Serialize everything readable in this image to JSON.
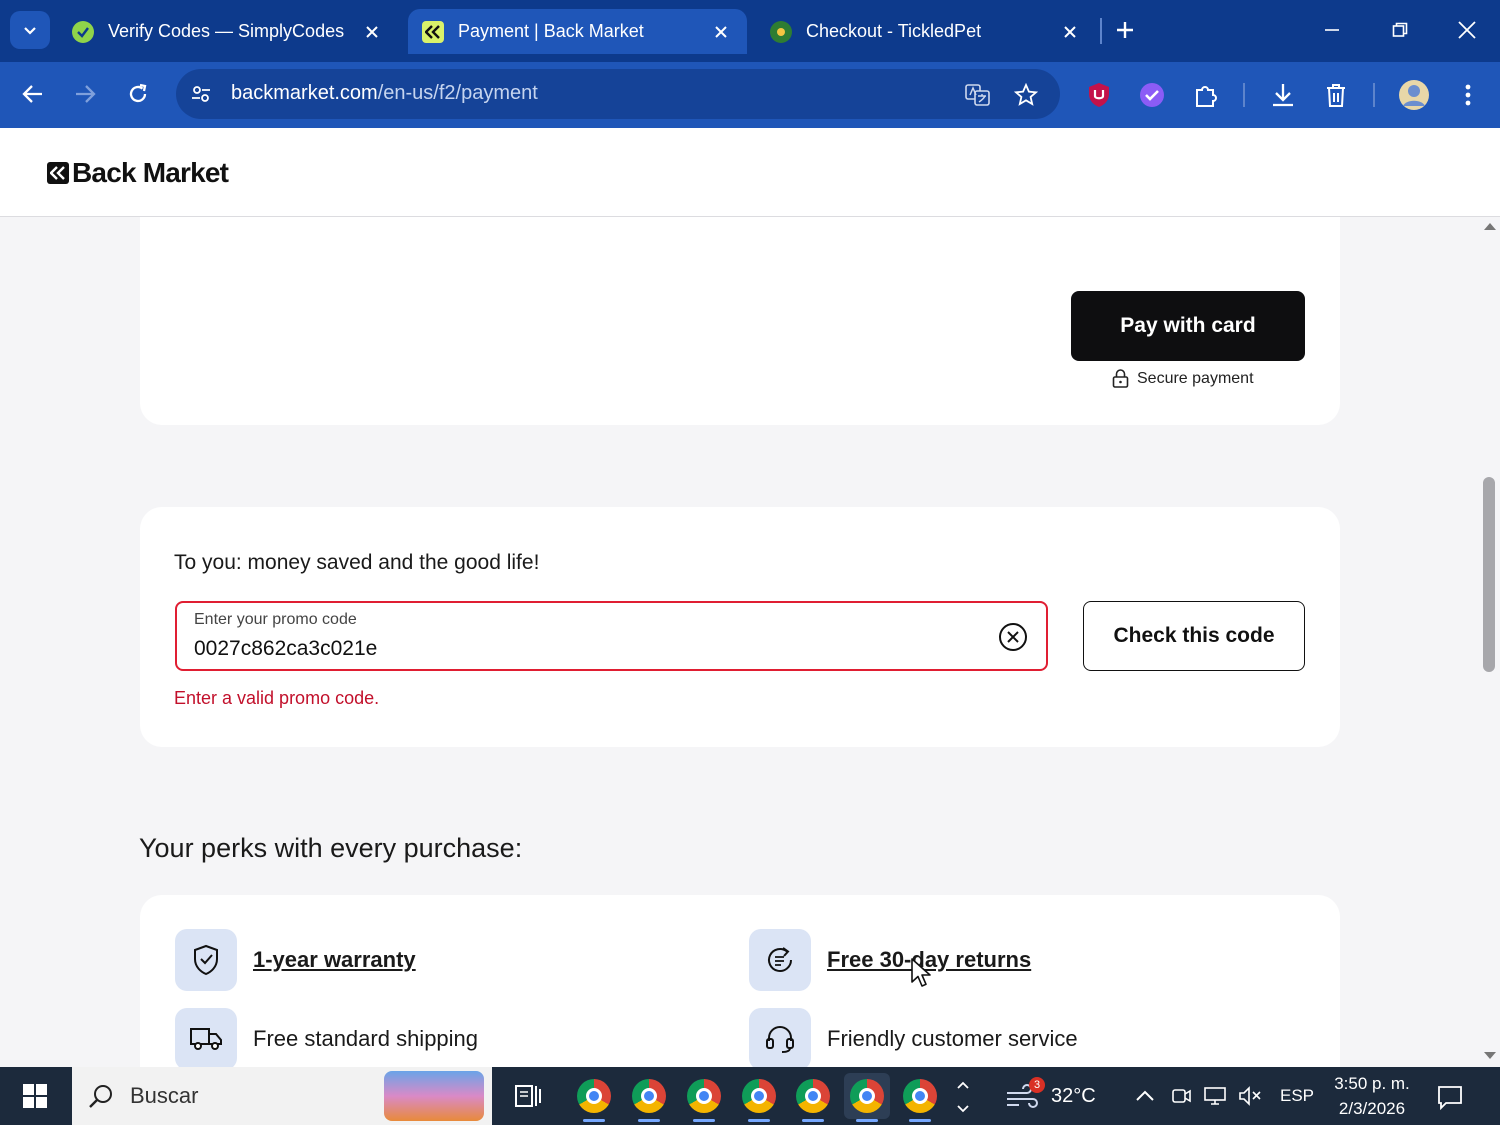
{
  "browser": {
    "tabs": [
      {
        "title": "Verify Codes — SimplyCodes",
        "icon": "simplycodes-icon",
        "active": false
      },
      {
        "title": "Payment | Back Market",
        "icon": "backmarket-icon",
        "active": true
      },
      {
        "title": "Checkout - TickledPet",
        "icon": "tickledpet-icon",
        "active": false
      }
    ],
    "url_host": "backmarket.com",
    "url_path": "/en-us/f2/payment"
  },
  "site": {
    "logo_text": "Back Market"
  },
  "payment": {
    "pay_button_label": "Pay with card",
    "secure_label": "Secure payment"
  },
  "promo": {
    "title": "To you: money saved and the good life!",
    "field_label": "Enter your promo code",
    "field_value": "0027c862ca3c021e",
    "error": "Enter a valid promo code.",
    "check_button_label": "Check this code",
    "error_color": "#c2102b"
  },
  "perks": {
    "title": "Your perks with every purchase:",
    "items": [
      {
        "label": "1-year warranty",
        "icon": "shield-check-icon",
        "link": true
      },
      {
        "label": "Free 30-day returns",
        "icon": "return-arrow-icon",
        "link": true
      },
      {
        "label": "Free standard shipping",
        "icon": "truck-icon",
        "link": false
      },
      {
        "label": "Friendly customer service",
        "icon": "headset-icon",
        "link": false
      }
    ]
  },
  "taskbar": {
    "search_placeholder": "Buscar",
    "weather_badge": "3",
    "temperature": "32°C",
    "language": "ESP",
    "time": "3:50 p. m.",
    "date": "2/3/2026"
  }
}
